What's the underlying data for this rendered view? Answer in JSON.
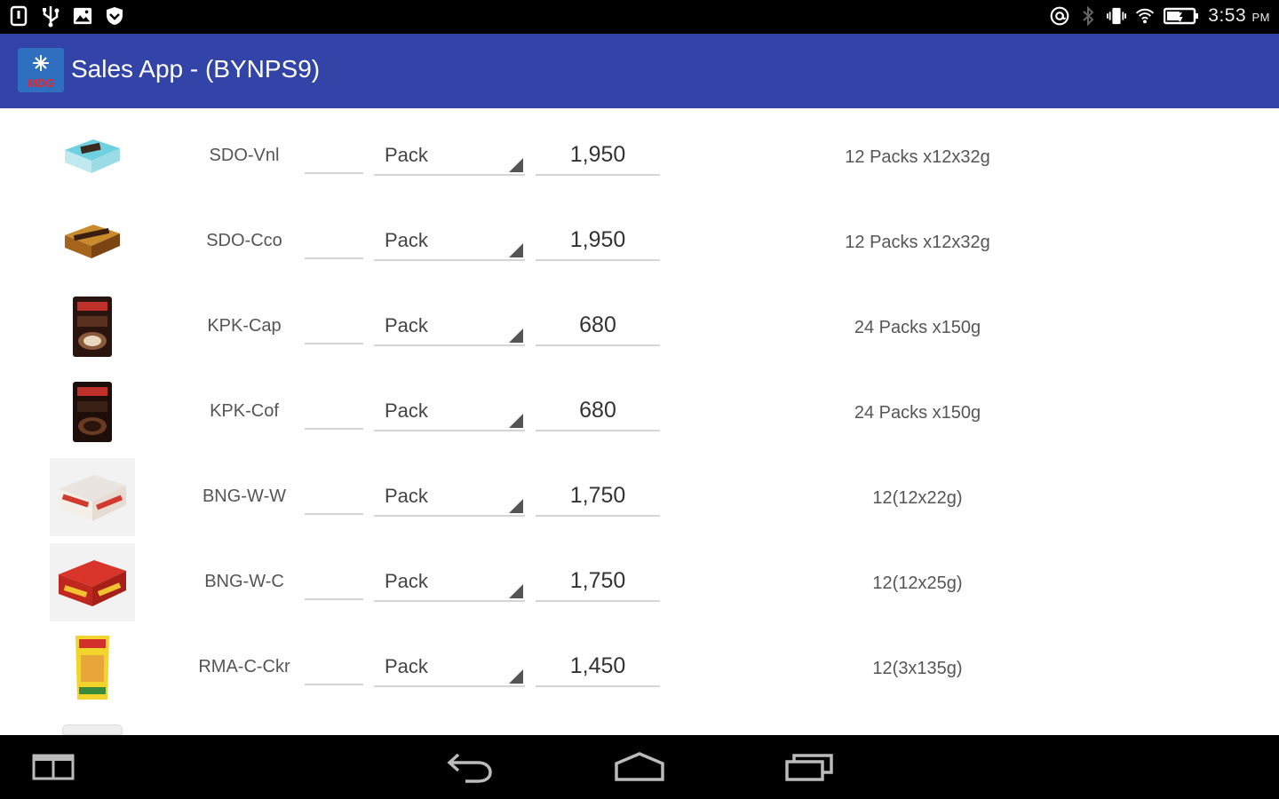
{
  "status_bar": {
    "time": "3:53",
    "ampm": "PM",
    "icons": [
      "notification-icon",
      "usb-icon",
      "image-icon",
      "shield-icon",
      "at-icon",
      "bluetooth-icon",
      "vibrate-icon",
      "wifi-icon",
      "battery-icon"
    ]
  },
  "app_bar": {
    "title": "Sales App - (BYNPS9)",
    "logo_text": "MDG",
    "brand_color": "#3344a8"
  },
  "products": [
    {
      "code": "SDO-Vnl",
      "qty": "",
      "unit": "Pack",
      "price": "1,950",
      "pack_size": "12 Packs x12x32g"
    },
    {
      "code": "SDO-Cco",
      "qty": "",
      "unit": "Pack",
      "price": "1,950",
      "pack_size": "12 Packs x12x32g"
    },
    {
      "code": "KPK-Cap",
      "qty": "",
      "unit": "Pack",
      "price": "680",
      "pack_size": "24 Packs x150g"
    },
    {
      "code": "KPK-Cof",
      "qty": "",
      "unit": "Pack",
      "price": "680",
      "pack_size": "24 Packs x150g"
    },
    {
      "code": "BNG-W-W",
      "qty": "",
      "unit": "Pack",
      "price": "1,750",
      "pack_size": "12(12x22g)"
    },
    {
      "code": "BNG-W-C",
      "qty": "",
      "unit": "Pack",
      "price": "1,750",
      "pack_size": "12(12x25g)"
    },
    {
      "code": "RMA-C-Ckr",
      "qty": "",
      "unit": "Pack",
      "price": "1,450",
      "pack_size": "12(3x135g)"
    }
  ],
  "nav_bar": {
    "buttons": [
      "split-screen-icon",
      "back-icon",
      "home-icon",
      "recents-icon"
    ]
  }
}
